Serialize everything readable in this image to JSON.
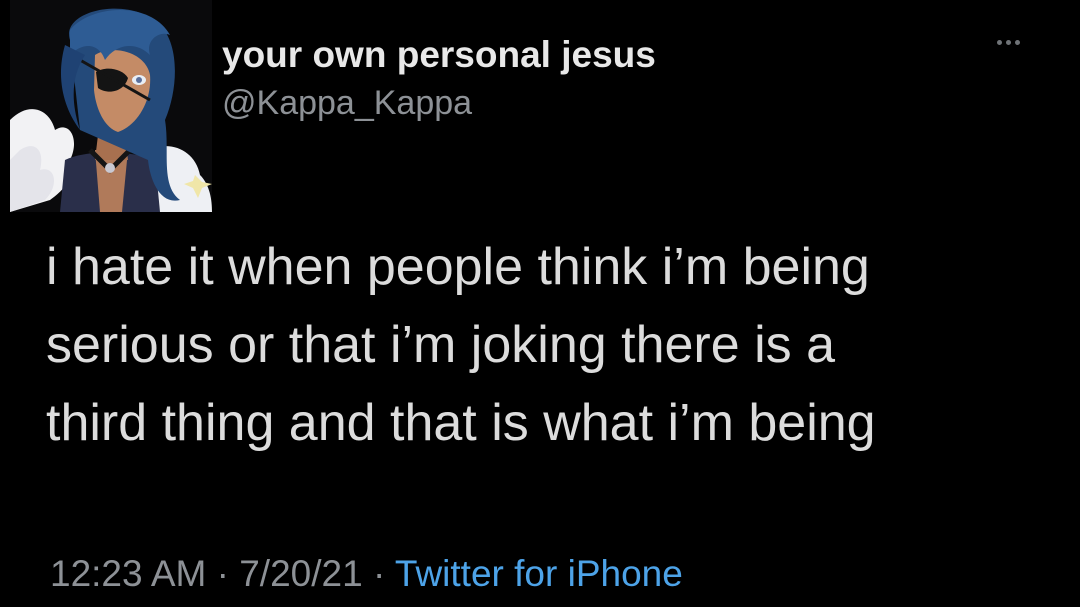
{
  "user": {
    "display_name": "your own personal jesus",
    "handle": "@Kappa_Kappa",
    "avatar_icon": "anime-character-avatar"
  },
  "more_icon": "more-horizontal-icon",
  "tweet": {
    "lines": [
      "i hate it when people think i’m being",
      "serious or that i’m joking there is a",
      "third thing and that is what i’m being"
    ]
  },
  "meta": {
    "time": "12:23 AM",
    "separator": " · ",
    "date": "7/20/21",
    "source": "Twitter for iPhone"
  },
  "colors": {
    "background": "#000000",
    "text": "#dcdcdc",
    "secondary": "#8d9196",
    "link": "#4da3e8"
  }
}
